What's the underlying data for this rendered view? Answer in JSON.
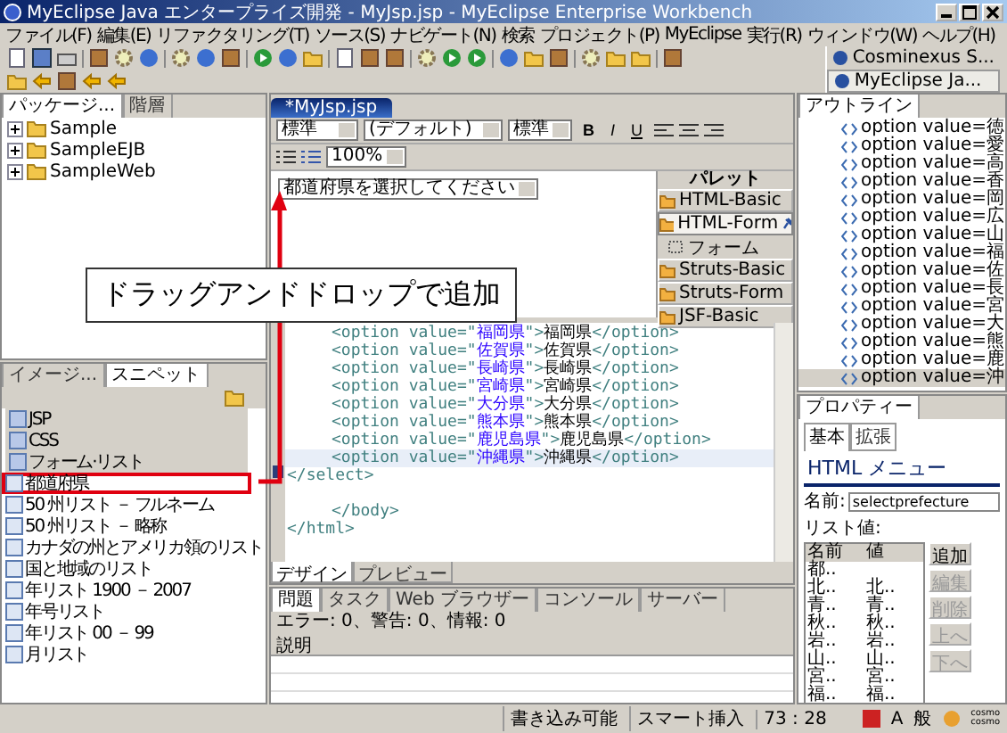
{
  "window": {
    "title": "MyEclipse Java エンタープライズ開発 - MyJsp.jsp - MyEclipse Enterprise Workbench"
  },
  "menu": [
    "ファイル(F)",
    "編集(E)",
    "リファクタリング(T)",
    "ソース(S)",
    "ナビゲート(N)",
    "検索",
    "プロジェクト(P)",
    "MyEclipse",
    "実行(R)",
    "ウィンドウ(W)",
    "ヘルプ(H)"
  ],
  "perspectives": [
    {
      "label": "Cosminexus S...",
      "selected": false
    },
    {
      "label": "MyEclipse Ja...",
      "selected": true
    }
  ],
  "package_view": {
    "tabs": [
      {
        "label": "パッケージ...",
        "selected": true
      },
      {
        "label": "階層",
        "selected": false
      }
    ],
    "tree": [
      {
        "label": "Sample",
        "expanded": false
      },
      {
        "label": "SampleEJB",
        "expanded": false
      },
      {
        "label": "SampleWeb",
        "expanded": false
      }
    ]
  },
  "snippets_view": {
    "tabs": [
      {
        "label": "イメージ...",
        "selected": false
      },
      {
        "label": "スニペット",
        "selected": true
      }
    ],
    "items": [
      {
        "kind": "category",
        "label": "JSP",
        "selected": false
      },
      {
        "kind": "category",
        "label": "CSS",
        "selected": false
      },
      {
        "kind": "category",
        "label": "フォーム·リスト",
        "selected": false
      },
      {
        "kind": "item",
        "label": "都道府県",
        "selected": true
      },
      {
        "kind": "item",
        "label": "50 州リスト － フルネーム",
        "selected": false
      },
      {
        "kind": "item",
        "label": "50 州リスト － 略称",
        "selected": false
      },
      {
        "kind": "item",
        "label": "カナダの州とアメリカ領のリスト",
        "selected": false
      },
      {
        "kind": "item",
        "label": "国と地域のリスト",
        "selected": false
      },
      {
        "kind": "item",
        "label": "年リスト 1900 － 2007",
        "selected": false
      },
      {
        "kind": "item",
        "label": "年号リスト",
        "selected": false
      },
      {
        "kind": "item",
        "label": "年リスト 00 － 99",
        "selected": false
      },
      {
        "kind": "item",
        "label": "月リスト",
        "selected": false
      }
    ]
  },
  "editor": {
    "tab": "*MyJsp.jsp",
    "format_bar": {
      "style": "標準",
      "font": "(デフォルト)",
      "size": "標準",
      "bold": "B",
      "italic": "I",
      "underline": "U"
    },
    "zoom": "100%",
    "design_select": "都道府県を選択してください",
    "palette": {
      "title": "パレット",
      "drawers": [
        {
          "label": "HTML-Basic",
          "expanded": false
        },
        {
          "label": "HTML-Form",
          "expanded": true,
          "items": [
            "フォーム"
          ]
        },
        {
          "label": "Struts-Basic",
          "expanded": false
        },
        {
          "label": "Struts-Form",
          "expanded": false
        },
        {
          "label": "JSF-Basic",
          "expanded": false
        }
      ]
    },
    "source_lines": [
      {
        "kind": "nested",
        "selected": false,
        "tokens": [
          {
            "kind": "tag",
            "text": "<option value=\""
          },
          {
            "kind": "value",
            "text": "福岡県"
          },
          {
            "kind": "tag",
            "text": "\">"
          },
          {
            "kind": "text",
            "text": "福岡県"
          },
          {
            "kind": "tag",
            "text": "</option>"
          }
        ]
      },
      {
        "kind": "nested",
        "selected": false,
        "tokens": [
          {
            "kind": "tag",
            "text": "<option value=\""
          },
          {
            "kind": "value",
            "text": "佐賀県"
          },
          {
            "kind": "tag",
            "text": "\">"
          },
          {
            "kind": "text",
            "text": "佐賀県"
          },
          {
            "kind": "tag",
            "text": "</option>"
          }
        ]
      },
      {
        "kind": "nested",
        "selected": false,
        "tokens": [
          {
            "kind": "tag",
            "text": "<option value=\""
          },
          {
            "kind": "value",
            "text": "長崎県"
          },
          {
            "kind": "tag",
            "text": "\">"
          },
          {
            "kind": "text",
            "text": "長崎県"
          },
          {
            "kind": "tag",
            "text": "</option>"
          }
        ]
      },
      {
        "kind": "nested",
        "selected": false,
        "tokens": [
          {
            "kind": "tag",
            "text": "<option value=\""
          },
          {
            "kind": "value",
            "text": "宮崎県"
          },
          {
            "kind": "tag",
            "text": "\">"
          },
          {
            "kind": "text",
            "text": "宮崎県"
          },
          {
            "kind": "tag",
            "text": "</option>"
          }
        ]
      },
      {
        "kind": "nested",
        "selected": false,
        "tokens": [
          {
            "kind": "tag",
            "text": "<option value=\""
          },
          {
            "kind": "value",
            "text": "大分県"
          },
          {
            "kind": "tag",
            "text": "\">"
          },
          {
            "kind": "text",
            "text": "大分県"
          },
          {
            "kind": "tag",
            "text": "</option>"
          }
        ]
      },
      {
        "kind": "nested",
        "selected": false,
        "tokens": [
          {
            "kind": "tag",
            "text": "<option value=\""
          },
          {
            "kind": "value",
            "text": "熊本県"
          },
          {
            "kind": "tag",
            "text": "\">"
          },
          {
            "kind": "text",
            "text": "熊本県"
          },
          {
            "kind": "tag",
            "text": "</option>"
          }
        ]
      },
      {
        "kind": "nested",
        "selected": false,
        "tokens": [
          {
            "kind": "tag",
            "text": "<option value=\""
          },
          {
            "kind": "value",
            "text": "鹿児島県"
          },
          {
            "kind": "tag",
            "text": "\">"
          },
          {
            "kind": "text",
            "text": "鹿児島県"
          },
          {
            "kind": "tag",
            "text": "</option>"
          }
        ]
      },
      {
        "kind": "nested",
        "selected": true,
        "tokens": [
          {
            "kind": "tag",
            "text": "<option value=\""
          },
          {
            "kind": "value",
            "text": "沖縄県"
          },
          {
            "kind": "tag",
            "text": "\">"
          },
          {
            "kind": "text",
            "text": "沖縄県"
          },
          {
            "kind": "tag",
            "text": "</option>"
          }
        ]
      },
      {
        "kind": "top",
        "selected": false,
        "tokens": [
          {
            "kind": "tag",
            "text": "</select>"
          }
        ]
      },
      {
        "kind": "blank",
        "selected": false
      },
      {
        "kind": "nested",
        "selected": false,
        "tokens": [
          {
            "kind": "tag",
            "text": "</body>"
          }
        ]
      },
      {
        "kind": "top",
        "selected": false,
        "tokens": [
          {
            "kind": "tag",
            "text": "</html>"
          }
        ]
      }
    ],
    "bottom_tabs": [
      {
        "label": "デザイン",
        "selected": true
      },
      {
        "label": "プレビュー",
        "selected": false
      }
    ]
  },
  "problems_view": {
    "tabs": [
      {
        "label": "問題",
        "selected": true
      },
      {
        "label": "タスク",
        "selected": false
      },
      {
        "label": "Web ブラウザー",
        "selected": false
      },
      {
        "label": "コンソール",
        "selected": false
      },
      {
        "label": "サーバー",
        "selected": false
      }
    ],
    "summary": "エラー: 0、警告: 0、情報: 0",
    "columns": [
      "説明"
    ]
  },
  "outline_view": {
    "tab": "アウトライン",
    "items": [
      {
        "label": "option value=徳",
        "selected": false
      },
      {
        "label": "option value=愛",
        "selected": false
      },
      {
        "label": "option value=高",
        "selected": false
      },
      {
        "label": "option value=香",
        "selected": false
      },
      {
        "label": "option value=岡",
        "selected": false
      },
      {
        "label": "option value=広",
        "selected": false
      },
      {
        "label": "option value=山",
        "selected": false
      },
      {
        "label": "option value=福",
        "selected": false
      },
      {
        "label": "option value=佐",
        "selected": false
      },
      {
        "label": "option value=長",
        "selected": false
      },
      {
        "label": "option value=宮",
        "selected": false
      },
      {
        "label": "option value=大",
        "selected": false
      },
      {
        "label": "option value=熊",
        "selected": false
      },
      {
        "label": "option value=鹿",
        "selected": false
      },
      {
        "label": "option value=沖",
        "selected": true
      }
    ]
  },
  "properties_view": {
    "tab": "プロパティー",
    "subtabs": [
      {
        "label": "基本",
        "selected": true
      },
      {
        "label": "拡張",
        "selected": false
      }
    ],
    "heading": "HTML メニュー",
    "name_label": "名前:",
    "name_value": "selectprefecture",
    "list_label": "リスト値:",
    "columns": [
      "名前",
      "値"
    ],
    "rows": [
      {
        "name": "都.."
      },
      {
        "name": "北..",
        "value": "北.."
      },
      {
        "name": "青..",
        "value": "青.."
      },
      {
        "name": "秋..",
        "value": "秋.."
      },
      {
        "name": "岩..",
        "value": "岩.."
      },
      {
        "name": "山..",
        "value": "山.."
      },
      {
        "name": "宮..",
        "value": "宮.."
      },
      {
        "name": "福..",
        "value": "福.."
      }
    ],
    "buttons": [
      {
        "label": "追加",
        "disabled": false
      },
      {
        "label": "編集",
        "disabled": true
      },
      {
        "label": "削除",
        "disabled": true
      },
      {
        "label": "上へ",
        "disabled": true
      },
      {
        "label": "下へ",
        "disabled": true
      }
    ]
  },
  "status_bar": {
    "fields": [
      "書き込み可能",
      "スマート挿入",
      "73 : 28"
    ],
    "ime": [
      "A",
      "般"
    ],
    "tray": [
      "cosmo",
      "cosmo"
    ]
  },
  "callout": "ドラッグアンドドロップで追加"
}
